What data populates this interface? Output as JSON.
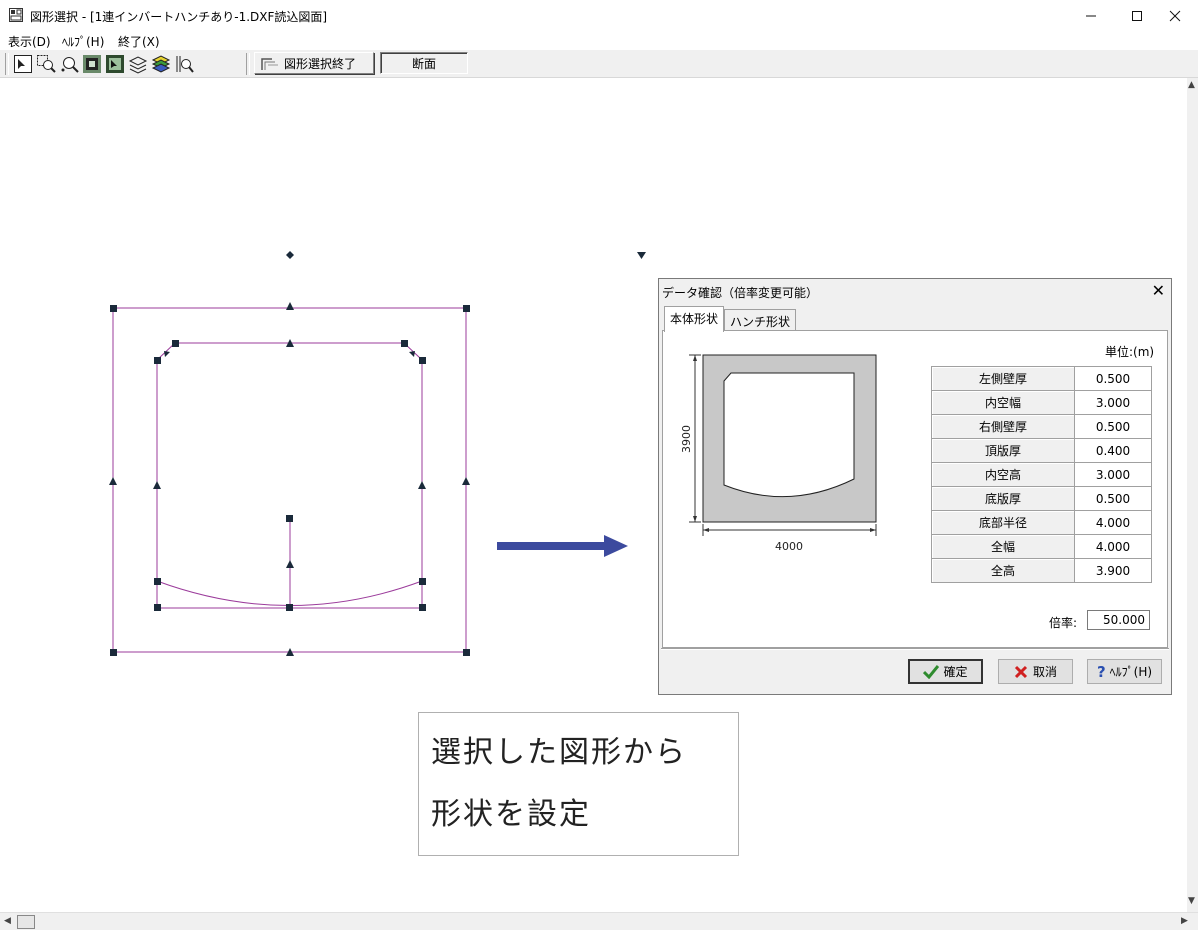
{
  "window": {
    "title": "図形選択 - [1連インバートハンチあり-1.DXF読込図面]"
  },
  "menu": {
    "items": [
      "表示(D)",
      "ﾍﾙﾌﾟ(H)",
      "終了(X)"
    ]
  },
  "toolbar": {
    "finish_label": "図形選択終了",
    "section_label": "断面"
  },
  "dialog": {
    "title": "データ確認（倍率変更可能）",
    "tabs": [
      "本体形状",
      "ハンチ形状"
    ],
    "unit": "単位:(m)",
    "fig_height_label": "3900",
    "fig_width_label": "4000",
    "rows": [
      {
        "name": "左側壁厚",
        "value": "0.500"
      },
      {
        "name": "内空幅",
        "value": "3.000"
      },
      {
        "name": "右側壁厚",
        "value": "0.500"
      },
      {
        "name": "頂版厚",
        "value": "0.400"
      },
      {
        "name": "内空高",
        "value": "3.000"
      },
      {
        "name": "底版厚",
        "value": "0.500"
      },
      {
        "name": "底部半径",
        "value": "4.000"
      },
      {
        "name": "全幅",
        "value": "4.000"
      },
      {
        "name": "全高",
        "value": "3.900"
      }
    ],
    "ratio_label": "倍率:",
    "ratio_value": "50.000",
    "ok_label": "確定",
    "cancel_label": "取消",
    "help_label": "ﾍﾙﾌﾟ(H)"
  },
  "note": {
    "line1": "選択した図形から",
    "line2": "形状を設定"
  },
  "colors": {
    "drawing_line": "#9b3b9b",
    "arrow": "#3c4a9e",
    "handle": "#1a2a3a"
  }
}
